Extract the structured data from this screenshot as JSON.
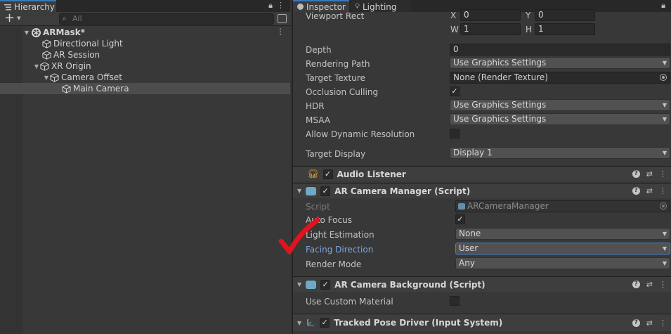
{
  "hierarchy": {
    "tab_label": "Hierarchy",
    "search_placeholder": "All",
    "add_label": "+",
    "scene": "ARMask*",
    "items": [
      {
        "label": "Directional Light"
      },
      {
        "label": "AR Session"
      },
      {
        "label": "XR Origin"
      },
      {
        "label": "Camera Offset"
      },
      {
        "label": "Main Camera"
      }
    ]
  },
  "inspector": {
    "tabs": [
      {
        "label": "Inspector"
      },
      {
        "label": "Lighting"
      }
    ],
    "viewport": {
      "label": "Viewport Rect",
      "x_axis": "X",
      "x": "0",
      "y_axis": "Y",
      "y": "0",
      "w_axis": "W",
      "w": "1",
      "h_axis": "H",
      "h": "1"
    },
    "depth": {
      "label": "Depth",
      "value": "0"
    },
    "rendering_path": {
      "label": "Rendering Path",
      "value": "Use Graphics Settings"
    },
    "target_texture": {
      "label": "Target Texture",
      "value": "None (Render Texture)"
    },
    "occlusion_culling": {
      "label": "Occlusion Culling",
      "checked": true
    },
    "hdr": {
      "label": "HDR",
      "value": "Use Graphics Settings"
    },
    "msaa": {
      "label": "MSAA",
      "value": "Use Graphics Settings"
    },
    "allow_dynamic_resolution": {
      "label": "Allow Dynamic Resolution",
      "checked": false
    },
    "target_display": {
      "label": "Target Display",
      "value": "Display 1"
    },
    "audio_listener": {
      "title": "Audio Listener"
    },
    "ar_camera_manager": {
      "title": "AR Camera Manager (Script)",
      "script": {
        "label": "Script",
        "value": "ARCameraManager"
      },
      "auto_focus": {
        "label": "Auto Focus",
        "checked": true
      },
      "light_estimation": {
        "label": "Light Estimation",
        "value": "None"
      },
      "facing_direction": {
        "label": "Facing Direction",
        "value": "User"
      },
      "render_mode": {
        "label": "Render Mode",
        "value": "Any"
      }
    },
    "ar_camera_background": {
      "title": "AR Camera Background (Script)",
      "use_custom_material": {
        "label": "Use Custom Material",
        "checked": false
      }
    },
    "tracked_pose_driver": {
      "title": "Tracked Pose Driver (Input System)"
    }
  },
  "colors": {
    "accent": "#3a79bb",
    "annotation": "#e0141e",
    "highlight_label": "#7ba6e0"
  }
}
